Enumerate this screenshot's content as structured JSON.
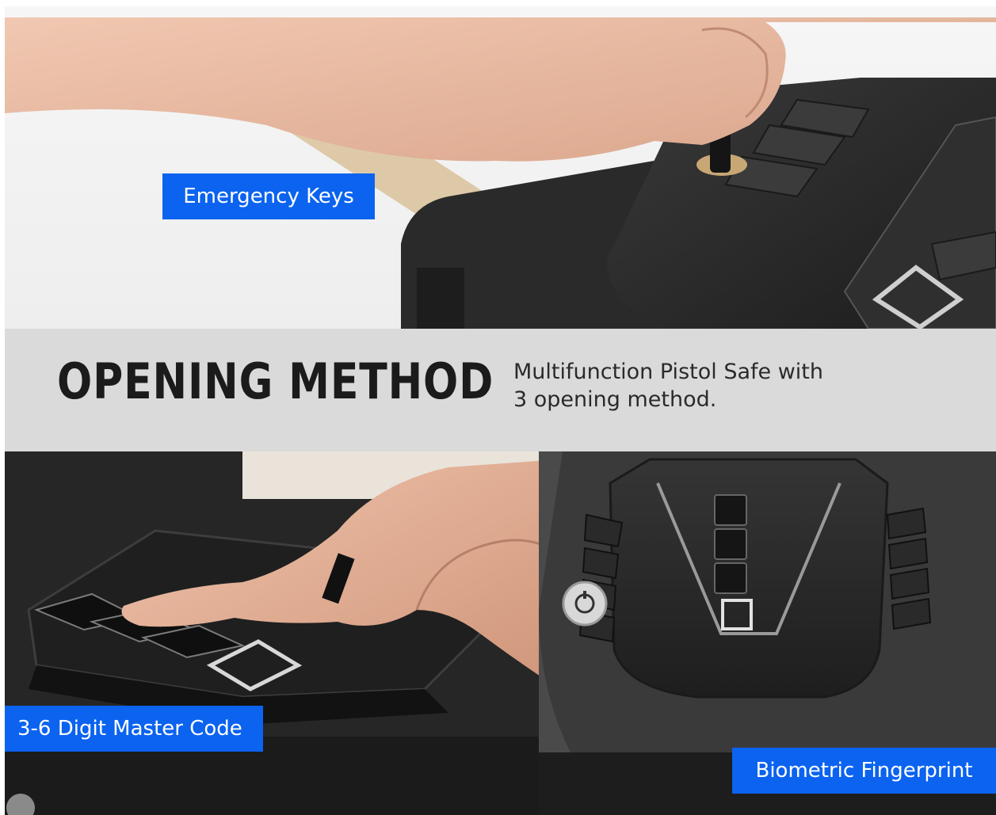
{
  "header": {
    "title": "OPENING METHOD",
    "subtitle_line1": "Multifunction Pistol Safe with",
    "subtitle_line2": "3 opening method."
  },
  "labels": {
    "emergency_keys": "Emergency Keys",
    "master_code": "3-6 Digit Master Code",
    "fingerprint": "Biometric Fingerprint"
  },
  "colors": {
    "label_background": "#0b63f0",
    "band_background": "#dadada",
    "headline": "#1b1b1b",
    "safe_body": "#2b2b2b"
  },
  "icons": [
    "hand-icon",
    "key-icon",
    "fingerprint-sensor-icon",
    "keypad-icon",
    "key-lock-icon"
  ]
}
